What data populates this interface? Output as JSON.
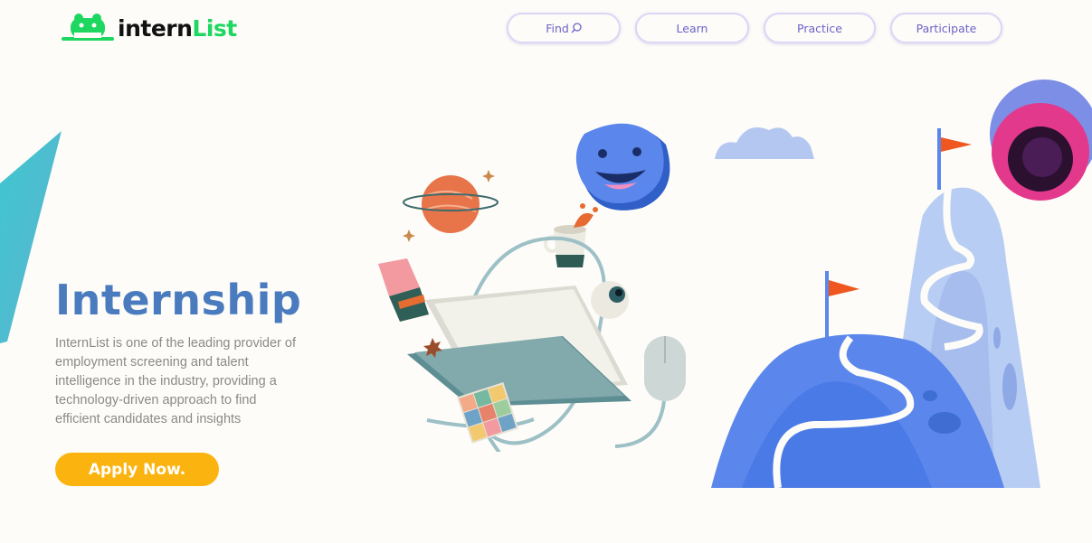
{
  "brand": {
    "name_part1": "intern",
    "name_part2": "List",
    "colors": {
      "primary": "#1ed760",
      "dark": "#111111"
    }
  },
  "nav": {
    "items": [
      {
        "label": "Find",
        "icon": "search-icon"
      },
      {
        "label": "Learn"
      },
      {
        "label": "Practice"
      },
      {
        "label": "Participate"
      }
    ]
  },
  "hero": {
    "title": "Internship",
    "description": "InternList is one of the leading provider of employment screening and talent intelligence in the industry, providing a technology-driven approach to find efficient candidates and insights",
    "cta_label": "Apply Now.",
    "colors": {
      "title": "#4a7bbf",
      "cta": "#fbb40f",
      "text": "#8a8a8a"
    }
  }
}
